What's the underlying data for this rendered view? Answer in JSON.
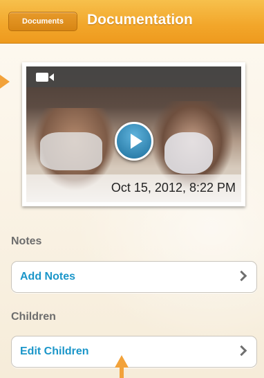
{
  "navbar": {
    "back_label": "Documents",
    "title": "Documentation"
  },
  "video": {
    "timestamp": "Oct 15, 2012, 8:22 PM",
    "type_icon": "video-camera-icon",
    "play_icon": "play-icon"
  },
  "sections": {
    "notes_label": "Notes",
    "add_notes_label": "Add Notes",
    "children_label": "Children",
    "edit_children_label": "Edit Children"
  },
  "colors": {
    "accent": "#f2a62a",
    "link": "#1b96c9",
    "section_text": "#6d6d6d"
  }
}
